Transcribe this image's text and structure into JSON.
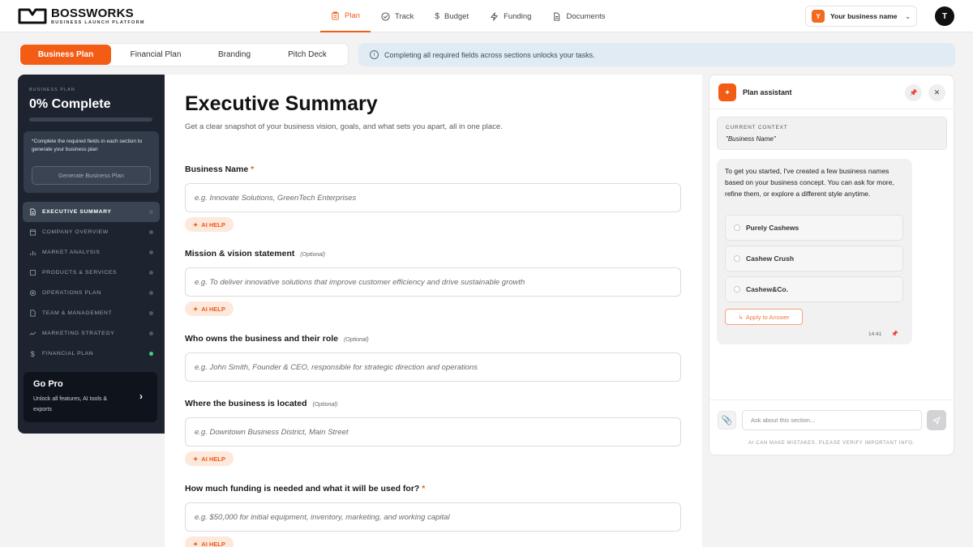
{
  "brand": {
    "name": "BOSSWORKS",
    "tagline": "BUSINESS LAUNCH PLATFORM"
  },
  "nav": [
    {
      "label": "Plan",
      "icon": "clipboard-icon",
      "active": true
    },
    {
      "label": "Track",
      "icon": "check-circle-icon"
    },
    {
      "label": "Budget",
      "icon": "dollar-icon"
    },
    {
      "label": "Funding",
      "icon": "lightning-icon"
    },
    {
      "label": "Documents",
      "icon": "document-icon"
    }
  ],
  "business_select": {
    "badge": "Y",
    "label": "Your business name"
  },
  "user": {
    "initial": "T"
  },
  "tabs": [
    "Business Plan",
    "Financial Plan",
    "Branding",
    "Pitch Deck"
  ],
  "banner": {
    "text": "Completing all required fields across sections unlocks your tasks."
  },
  "sidebar": {
    "eyebrow": "BUSINESS PLAN",
    "title": "0% Complete",
    "progress_percent": 0,
    "card_text": "*Complete the required fields in each section to generate your business plan",
    "generate_label": "Generate Business Plan",
    "items": [
      {
        "label": "EXECUTIVE SUMMARY",
        "icon": "document-icon"
      },
      {
        "label": "COMPANY OVERVIEW",
        "icon": "building-icon"
      },
      {
        "label": "MARKET ANALYSIS",
        "icon": "bar-chart-icon"
      },
      {
        "label": "PRODUCTS & SERVICES",
        "icon": "box-icon"
      },
      {
        "label": "OPERATIONS PLAN",
        "icon": "gear-icon"
      },
      {
        "label": "TEAM & MANAGEMENT",
        "icon": "team-icon"
      },
      {
        "label": "MARKETING STRATEGY",
        "icon": "trend-icon"
      },
      {
        "label": "FINANCIAL PLAN",
        "icon": "dollar-icon",
        "status": "complete"
      }
    ],
    "gopro": {
      "title": "Go Pro",
      "text": "Unlock all features, AI tools & exports"
    }
  },
  "main": {
    "title": "Executive Summary",
    "subtitle": "Get a clear snapshot of your business vision, goals, and what sets you apart, all in one place.",
    "ai_help_label": "AI HELP",
    "fields": [
      {
        "label": "Business Name",
        "required": "*",
        "optional": "",
        "placeholder": "e.g. Innovate Solutions, GreenTech Enterprises"
      },
      {
        "label": "Mission & vision statement",
        "required": "",
        "optional": "(Optional)",
        "placeholder": "e.g. To deliver innovative solutions that improve customer efficiency and drive sustainable growth"
      },
      {
        "label": "Who owns the business and their role",
        "required": "",
        "optional": "(Optional)",
        "placeholder": "e.g. John Smith, Founder & CEO, responsible for strategic direction and operations"
      },
      {
        "label": "Where the business is located",
        "required": "",
        "optional": "(Optional)",
        "placeholder": "e.g. Downtown Business District, Main Street"
      },
      {
        "label": "How much funding is needed and what it will be used for?",
        "required": "*",
        "optional": "",
        "placeholder": "e.g. $50,000 for initial equipment, inventory, marketing, and working capital"
      }
    ]
  },
  "assistant": {
    "title": "Plan assistant",
    "context_label": "CURRENT CONTEXT",
    "context_value": "\"Business Name\"",
    "message": "To get you started, I've created a few business names based on your business concept. You can ask for more, refine them, or explore a different style anytime.",
    "options": [
      "Purely Cashews",
      "Cashew Crush",
      "Cashew&Co."
    ],
    "apply_label": "Apply to Answer",
    "time": "14:41",
    "input_placeholder": "Ask about this section...",
    "disclaimer": "AI CAN MAKE MISTAKES. PLEASE VERIFY IMPORTANT INFO."
  },
  "colors": {
    "accent": "#f25c15",
    "sidebar": "#1d2430",
    "banner": "#e1ebf4",
    "status_green": "#3fd17a"
  }
}
